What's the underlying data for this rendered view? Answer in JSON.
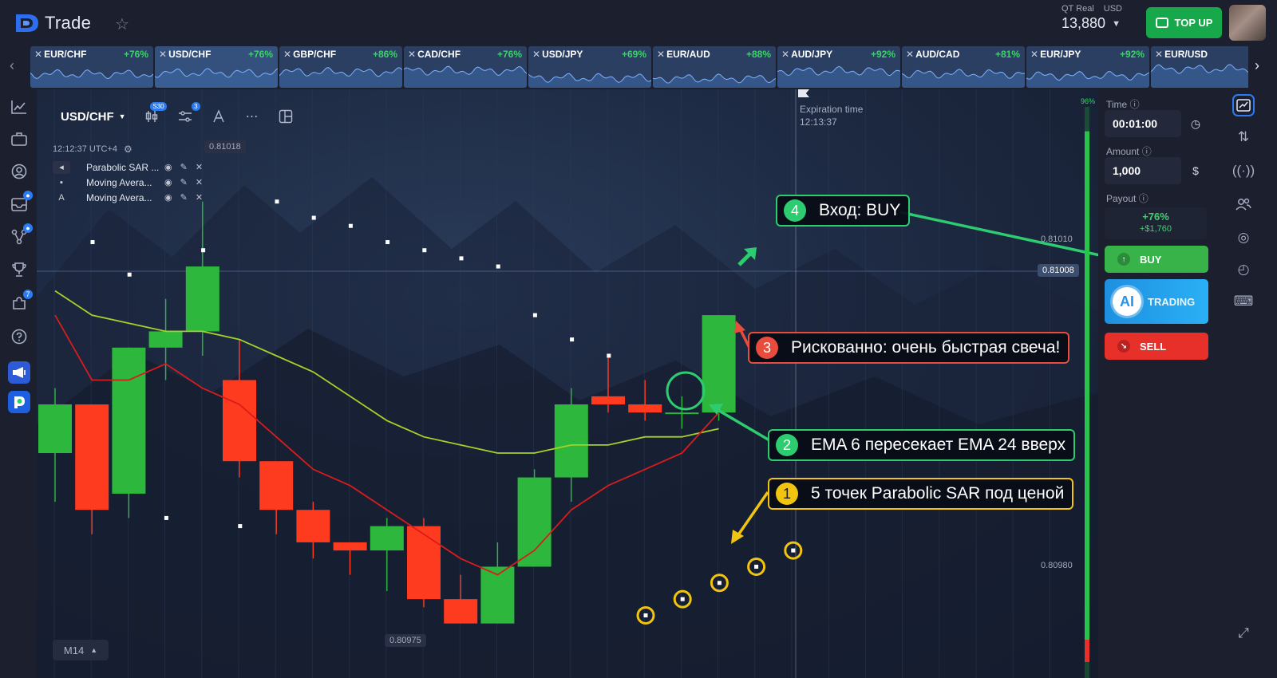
{
  "header": {
    "logo_text": "Trade",
    "account_type": "QT Real",
    "currency": "USD",
    "balance": "13,880",
    "topup_label": "TOP UP"
  },
  "assets": [
    {
      "name": "EUR/CHF",
      "payout": "+76%"
    },
    {
      "name": "USD/CHF",
      "payout": "+76%"
    },
    {
      "name": "GBP/CHF",
      "payout": "+86%"
    },
    {
      "name": "CAD/CHF",
      "payout": "+76%"
    },
    {
      "name": "USD/JPY",
      "payout": "+69%"
    },
    {
      "name": "EUR/AUD",
      "payout": "+88%"
    },
    {
      "name": "AUD/JPY",
      "payout": "+92%"
    },
    {
      "name": "AUD/CAD",
      "payout": "+81%"
    },
    {
      "name": "EUR/JPY",
      "payout": "+92%"
    },
    {
      "name": "EUR/USD",
      "payout": ""
    }
  ],
  "left_sidebar": {
    "items": [
      {
        "icon": "chart-line-icon",
        "badge": ""
      },
      {
        "icon": "briefcase-icon",
        "badge": ""
      },
      {
        "icon": "user-icon",
        "badge": ""
      },
      {
        "icon": "inbox-icon",
        "badge": ""
      },
      {
        "icon": "network-icon",
        "badge": ""
      },
      {
        "icon": "trophy-icon",
        "badge": ""
      },
      {
        "icon": "puzzle-icon",
        "badge": "7"
      },
      {
        "icon": "help-icon",
        "badge": ""
      },
      {
        "icon": "megaphone-icon",
        "badge": ""
      },
      {
        "icon": "app-logo-icon",
        "badge": ""
      }
    ]
  },
  "chart_toolbar": {
    "pair": "USD/CHF",
    "candle_badge": "S30",
    "indicator_badge": "3"
  },
  "chart": {
    "clock": "12:12:37 UTC+4",
    "indicators": [
      {
        "lead": "◂",
        "name": "Parabolic SAR ..."
      },
      {
        "lead": "▪",
        "name": "Moving Avera..."
      },
      {
        "lead": "A",
        "name": "Moving Avera..."
      }
    ],
    "price_top": "0.81018",
    "price_upper": "0.81010",
    "price_current": "0.81008",
    "price_lower": "0.80980",
    "price_bottom": "0.80975",
    "expiration_label": "Expiration time",
    "expiration_time": "12:13:37",
    "timeframe": "M14",
    "progress_pct": "96%",
    "progress_value": 0.96
  },
  "chart_data": {
    "type": "candlestick",
    "candles": [
      {
        "o": 0.80983,
        "c": 0.80989,
        "h": 0.80991,
        "l": 0.80977
      },
      {
        "o": 0.80989,
        "c": 0.80976,
        "h": 0.80989,
        "l": 0.80973
      },
      {
        "o": 0.80978,
        "c": 0.80996,
        "h": 0.80996,
        "l": 0.80975
      },
      {
        "o": 0.80996,
        "c": 0.80998,
        "h": 0.81002,
        "l": 0.80992
      },
      {
        "o": 0.80998,
        "c": 0.81006,
        "h": 0.81014,
        "l": 0.80995
      },
      {
        "o": 0.80992,
        "c": 0.80982,
        "h": 0.80997,
        "l": 0.8098
      },
      {
        "o": 0.80982,
        "c": 0.80976,
        "h": 0.80981,
        "l": 0.80973
      },
      {
        "o": 0.80976,
        "c": 0.80972,
        "h": 0.80977,
        "l": 0.8097
      },
      {
        "o": 0.80972,
        "c": 0.80971,
        "h": 0.80971,
        "l": 0.80968
      },
      {
        "o": 0.80971,
        "c": 0.80974,
        "h": 0.80975,
        "l": 0.80966
      },
      {
        "o": 0.80974,
        "c": 0.80965,
        "h": 0.80975,
        "l": 0.80964
      },
      {
        "o": 0.80965,
        "c": 0.80962,
        "h": 0.80968,
        "l": 0.80962
      },
      {
        "o": 0.80962,
        "c": 0.80969,
        "h": 0.80972,
        "l": 0.80962
      },
      {
        "o": 0.80969,
        "c": 0.8098,
        "h": 0.80981,
        "l": 0.80969
      },
      {
        "o": 0.8098,
        "c": 0.80989,
        "h": 0.80991,
        "l": 0.80977
      },
      {
        "o": 0.8099,
        "c": 0.80989,
        "h": 0.80995,
        "l": 0.80988
      },
      {
        "o": 0.80989,
        "c": 0.80988,
        "h": 0.80992,
        "l": 0.80987
      },
      {
        "o": 0.80988,
        "c": 0.80988,
        "h": 0.8099,
        "l": 0.80986
      },
      {
        "o": 0.80988,
        "c": 0.81,
        "h": 0.81,
        "l": 0.80987
      }
    ],
    "ema_fast": [
      0.81,
      0.80992,
      0.80992,
      0.80994,
      0.80991,
      0.80989,
      0.80985,
      0.80981,
      0.80979,
      0.80976,
      0.80973,
      0.8097,
      0.80968,
      0.80971,
      0.80976,
      0.80979,
      0.80981,
      0.80983,
      0.80988
    ],
    "ema_slow": [
      0.81003,
      0.81,
      0.80999,
      0.80998,
      0.80998,
      0.80997,
      0.80995,
      0.80993,
      0.8099,
      0.80987,
      0.80985,
      0.80984,
      0.80983,
      0.80983,
      0.80984,
      0.80984,
      0.80985,
      0.80985,
      0.80986
    ],
    "sar_points": [
      0.81009,
      0.81005,
      0.80975,
      0.81008,
      0.80974,
      0.81014,
      0.81012,
      0.81011,
      0.81009,
      0.81008,
      0.81007,
      0.81006,
      0.81,
      0.80997,
      0.80995,
      0.80963,
      0.80965,
      0.80967,
      0.80969,
      0.80971
    ],
    "ylim": [
      0.8096,
      0.81018
    ]
  },
  "annotations": {
    "a1": {
      "num": "1",
      "text": "5 точек Parabolic SAR под ценой"
    },
    "a2": {
      "num": "2",
      "text": "EMA 6 пересекает EMA 24 вверх"
    },
    "a3": {
      "num": "3",
      "text": "Рискованно: очень быстрая свеча!"
    },
    "a4": {
      "num": "4",
      "text": "Вход: BUY"
    }
  },
  "trade_panel": {
    "time_label": "Time",
    "time_value": "00:01:00",
    "amount_label": "Amount",
    "amount_value": "1,000",
    "payout_label": "Payout",
    "payout_pct": "+76%",
    "payout_amount": "+$1,760",
    "buy_label": "BUY",
    "ai_label": "AI",
    "ai_trading_label": "TRADING",
    "sell_label": "SELL"
  },
  "colors": {
    "bull": "#2db83d",
    "bear": "#ff3b1f",
    "ema_fast": "#d81c1c",
    "ema_slow": "#a4d12a",
    "annotation_green": "#2ecc71",
    "annotation_yellow": "#f1c40f",
    "annotation_red": "#e74c3c"
  }
}
